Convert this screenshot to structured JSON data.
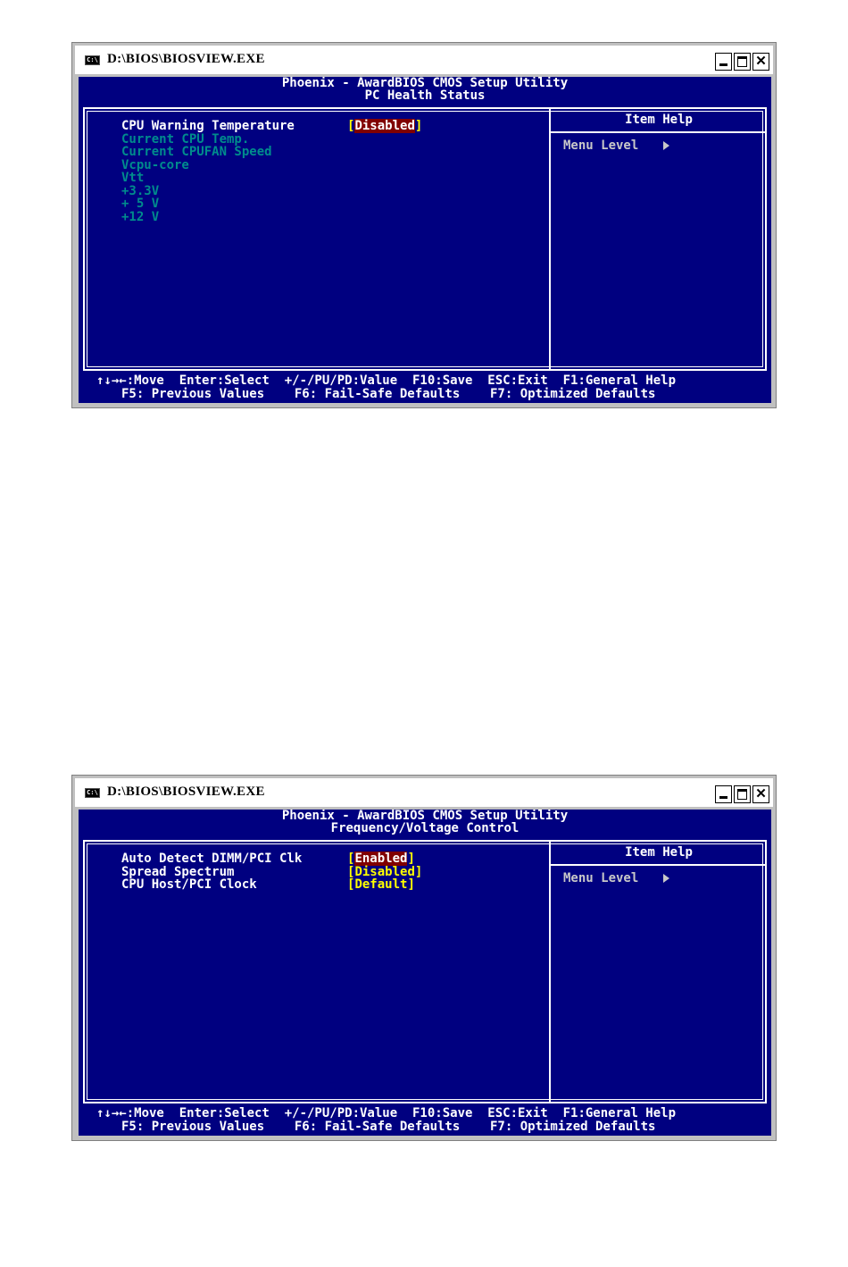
{
  "window1": {
    "title": "D:\\BIOS\\BIOSVIEW.EXE",
    "icon_text": "C:\\",
    "header_line1": "Phoenix - AwardBIOS CMOS Setup Utility",
    "header_line2": "PC Health Status",
    "items": [
      {
        "label": "CPU Warning Temperature",
        "value": "Disabled",
        "enabled": true
      },
      {
        "label": "Current CPU Temp.",
        "enabled": false
      },
      {
        "label": "Current CPUFAN Speed",
        "enabled": false
      },
      {
        "label": "Vcpu-core",
        "enabled": false
      },
      {
        "label": "Vtt",
        "enabled": false
      },
      {
        "label": "+3.3V",
        "enabled": false
      },
      {
        "label": "+ 5 V",
        "enabled": false
      },
      {
        "label": "+12 V",
        "enabled": false
      }
    ],
    "help_title": "Item Help",
    "help_menu_level": "Menu Level",
    "footer_line1": "↑↓→←:Move  Enter:Select  +/-/PU/PD:Value  F10:Save  ESC:Exit  F1:General Help",
    "footer_line2": "F5: Previous Values    F6: Fail-Safe Defaults    F7: Optimized Defaults"
  },
  "window2": {
    "title": "D:\\BIOS\\BIOSVIEW.EXE",
    "icon_text": "C:\\",
    "header_line1": "Phoenix - AwardBIOS CMOS Setup Utility",
    "header_line2": "Frequency/Voltage Control",
    "items": [
      {
        "label": "Auto Detect DIMM/PCI Clk",
        "value": "Enabled",
        "enabled": true,
        "selected": true
      },
      {
        "label": "Spread Spectrum",
        "value": "Disabled",
        "enabled": true
      },
      {
        "label": "CPU Host/PCI Clock",
        "value": "Default",
        "enabled": true
      }
    ],
    "help_title": "Item Help",
    "help_menu_level": "Menu Level",
    "footer_line1": "↑↓→←:Move  Enter:Select  +/-/PU/PD:Value  F10:Save  ESC:Exit  F1:General Help",
    "footer_line2": "F5: Previous Values    F6: Fail-Safe Defaults    F7: Optimized Defaults"
  },
  "colors": {
    "bios_background": "#000080",
    "text": "#ffffff",
    "value_text": "#ffff00",
    "highlight": "#800000",
    "disabled_item": "#008c8c"
  },
  "icons": {
    "window_icon": "console-icon",
    "minimize": "minimize-icon",
    "maximize": "maximize-icon",
    "close": "close-icon",
    "submenu_arrow": "triangle-right-icon"
  }
}
